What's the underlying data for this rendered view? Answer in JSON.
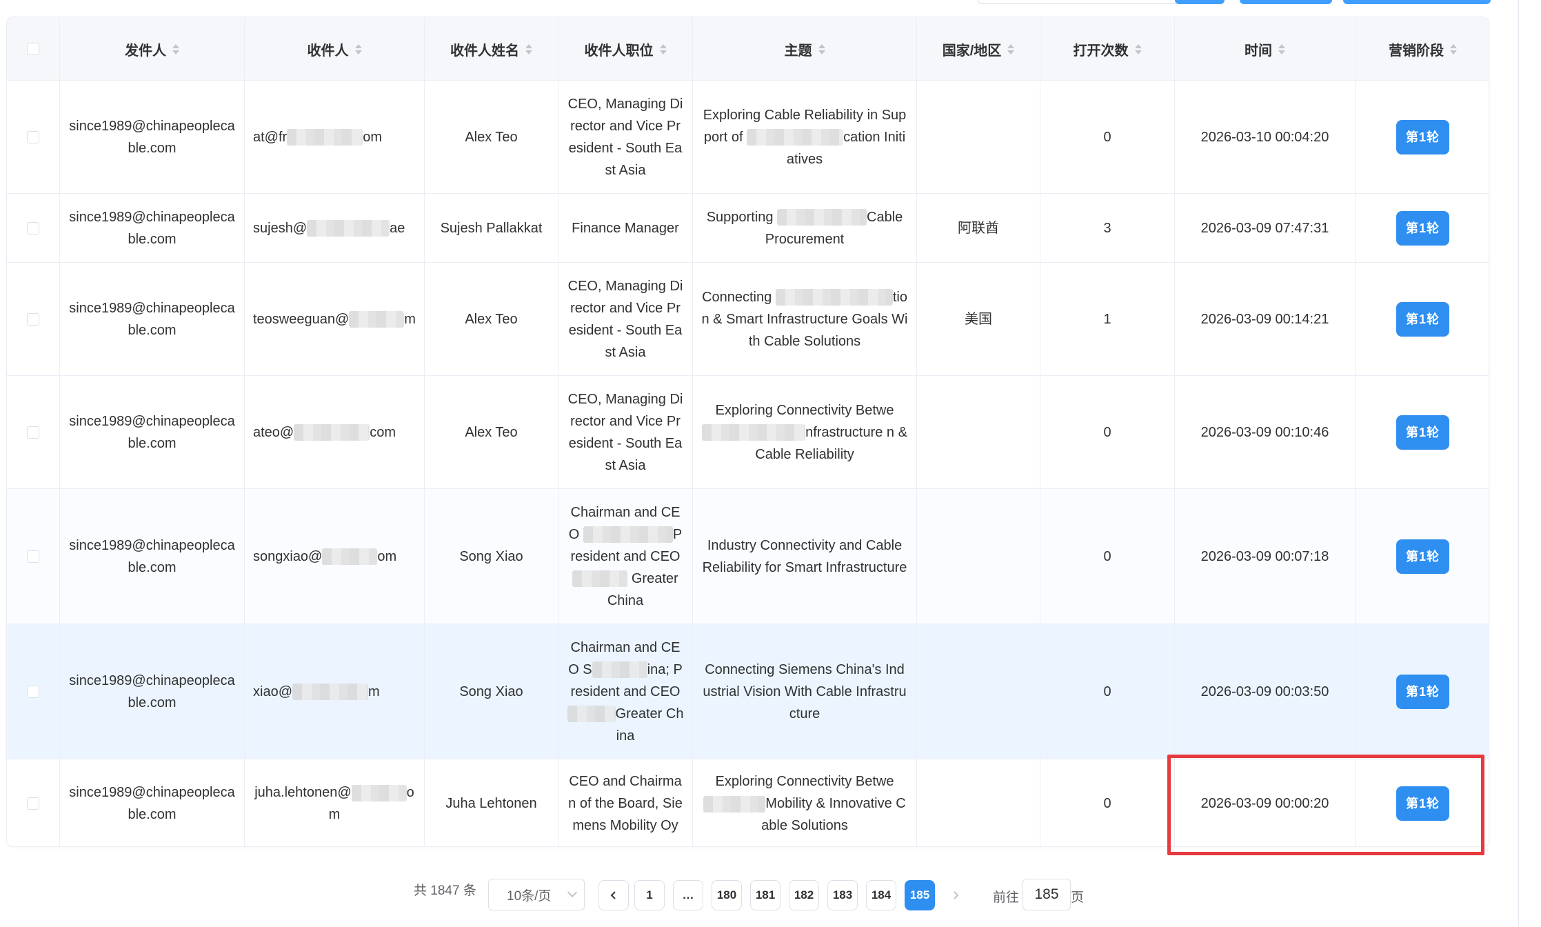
{
  "columns": {
    "sender": "发件人",
    "recipient": "收件人",
    "recipient_name": "收件人姓名",
    "recipient_title": "收件人职位",
    "subject": "主题",
    "country": "国家/地区",
    "open_count": "打开次数",
    "time": "时间",
    "stage": "营销阶段"
  },
  "rows": [
    {
      "sender": "since1989@chinapeoplecable.com",
      "recipient_a": "at@fr",
      "recipient_b": "om",
      "name": "Alex Teo",
      "title": "CEO, Managing Director and Vice President - South East Asia",
      "subject_a": "Exploring Cable Reliability in Support of ",
      "subject_b": "cation Initiatives",
      "country": "",
      "opens": "0",
      "time": "2026-03-10 00:04:20",
      "stage": "第1轮"
    },
    {
      "sender": "since1989@chinapeoplecable.com",
      "recipient_a": "sujesh@",
      "recipient_b": "ae",
      "name": "Sujesh Pallakkat",
      "title": "Finance Manager",
      "subject_a": "Supporting ",
      "subject_b": "Cable Procurement",
      "country": "阿联酋",
      "opens": "3",
      "time": "2026-03-09 07:47:31",
      "stage": "第1轮"
    },
    {
      "sender": "since1989@chinapeoplecable.com",
      "recipient_a": "teosweeguan@",
      "recipient_b": "m",
      "name": "Alex Teo",
      "title": "CEO, Managing Director and Vice President - South East Asia",
      "subject_a": "Connecting ",
      "subject_b": "tion & Smart Infrastructure Goals With Cable Solutions",
      "country": "美国",
      "opens": "1",
      "time": "2026-03-09 00:14:21",
      "stage": "第1轮"
    },
    {
      "sender": "since1989@chinapeoplecable.com",
      "recipient_a": "ateo@",
      "recipient_b": "com",
      "name": "Alex Teo",
      "title": "CEO, Managing Director and Vice President - South East Asia",
      "subject_a": "Exploring Connectivity Betwe",
      "subject_b": "nfrastructure n & Cable Reliability",
      "country": "",
      "opens": "0",
      "time": "2026-03-09 00:10:46",
      "stage": "第1轮"
    },
    {
      "sender": "since1989@chinapeoplecable.com",
      "recipient_a": "songxiao@",
      "recipient_b": "om",
      "name": "Song Xiao",
      "title_a": "Chairman and CEO ",
      "title_b": "President and CEO ",
      "title_c": " Greater China",
      "subject_a": "Industry Connectivity and Cable Reliability for Smart Infrastructure",
      "country": "",
      "opens": "0",
      "time": "2026-03-09 00:07:18",
      "stage": "第1轮"
    },
    {
      "sender": "since1989@chinapeoplecable.com",
      "recipient_a": "xiao@",
      "recipient_b": "m",
      "name": "Song Xiao",
      "title_a": "Chairman and CEO S",
      "title_b": "ina; President and CEO ",
      "title_c": "Greater China",
      "subject_a": "Connecting Siemens China's Industrial Vision With Cable Infrastructure",
      "country": "",
      "opens": "0",
      "time": "2026-03-09 00:03:50",
      "stage": "第1轮"
    },
    {
      "sender": "since1989@chinapeoplecable.com",
      "recipient_a": "juha.lehtonen@",
      "recipient_b": "om",
      "name": "Juha Lehtonen",
      "title": "CEO and Chairman of the Board, Siemens Mobility Oy",
      "subject_a": "Exploring Connectivity Betwe",
      "subject_b": "Mobility & Innovative Cable Solutions",
      "country": "",
      "opens": "0",
      "time": "2026-03-09 00:00:20",
      "stage": "第1轮"
    }
  ],
  "pagination": {
    "total": "共 1847 条",
    "page_size": "10条/页",
    "pages": [
      "1",
      "…",
      "180",
      "181",
      "182",
      "183",
      "184",
      "185"
    ],
    "current_page": "185",
    "goto_prefix": "前往",
    "goto_value": "185",
    "goto_suffix": "页",
    "prev_icon": "chevron-left-icon",
    "next_icon": "chevron-right-icon"
  },
  "colors": {
    "accent": "#2f8ff0",
    "highlight": "#e8393f",
    "header_bg": "#f5f7fa",
    "hover_row": "#ecf5ff"
  }
}
